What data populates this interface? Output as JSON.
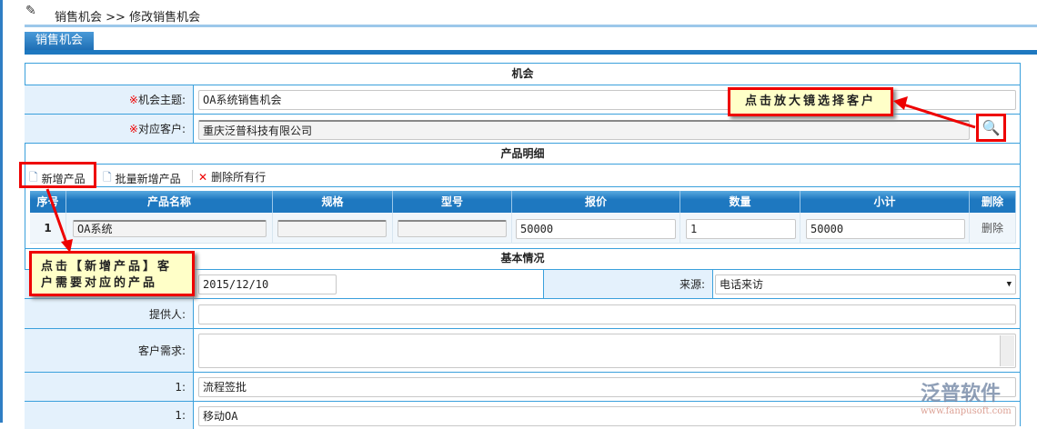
{
  "breadcrumb": {
    "root": "销售机会",
    "sep": ">>",
    "current": "修改销售机会"
  },
  "tab": "销售机会",
  "sections": {
    "opportunity": "机会",
    "products": "产品明细",
    "basic": "基本情况"
  },
  "fields": {
    "subject": {
      "label": "机会主题:",
      "value": "OA系统销售机会"
    },
    "customer": {
      "label": "对应客户:",
      "value": "重庆泛普科技有限公司"
    },
    "date": {
      "value": "2015/12/10"
    },
    "source": {
      "label": "来源:",
      "value": "电话来访"
    },
    "provider": {
      "label": "提供人:",
      "value": ""
    },
    "needs": {
      "label": "客户需求:",
      "value": ""
    },
    "extra1": {
      "label": "1:",
      "value": "流程签批"
    },
    "extra2": {
      "label": "1:",
      "value": "移动OA"
    }
  },
  "required_mark": "※",
  "toolbar": {
    "add": "新增产品",
    "batch_add": "批量新增产品",
    "delete_all": "删除所有行"
  },
  "table": {
    "headers": [
      "序号",
      "产品名称",
      "规格",
      "型号",
      "报价",
      "数量",
      "小计",
      "删除"
    ],
    "rows": [
      {
        "index": "1",
        "name": "OA系统",
        "spec": "",
        "model": "",
        "price": "50000",
        "qty": "1",
        "subtotal": "50000",
        "delete": "删除"
      }
    ]
  },
  "callouts": {
    "magnifier": "点击放大镜选择客户",
    "add_product": "点击【新增产品】客户需要对应的产品"
  },
  "watermark": {
    "brand": "泛普软件",
    "url": "www.fanpusoft.com"
  }
}
